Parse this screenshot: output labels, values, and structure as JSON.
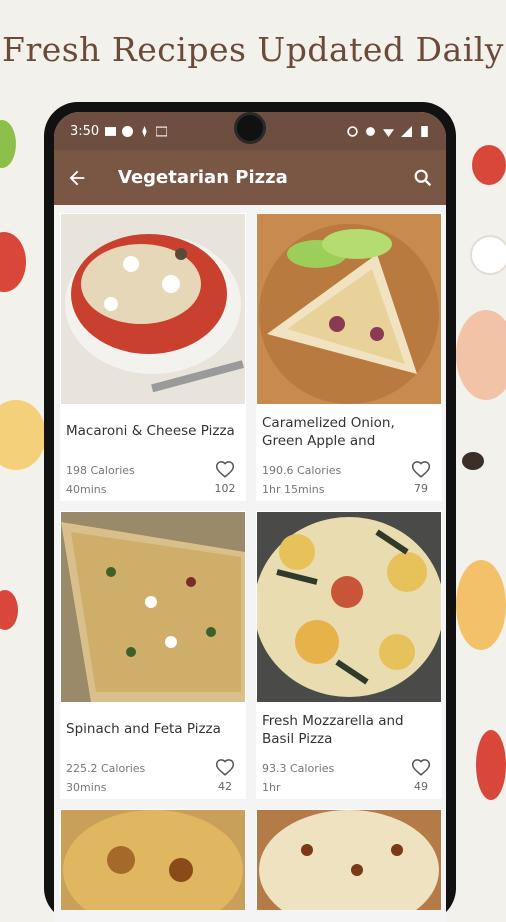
{
  "headline": "Fresh Recipes Updated Daily",
  "status": {
    "time": "3:50"
  },
  "appbar": {
    "title": "Vegetarian Pizza",
    "back_icon": "arrow-left-icon",
    "search_icon": "search-icon"
  },
  "colors": {
    "appbar": "#7a5645",
    "statusbar": "#6e4e40",
    "accent": "#6b4a3a"
  },
  "recipes": [
    {
      "name": "Macaroni & Cheese Pizza",
      "calories": "198 Calories",
      "time": "40mins",
      "likes": "102"
    },
    {
      "name": "Caramelized Onion, Green Apple and",
      "calories": "190.6 Calories",
      "time": "1hr 15mins",
      "likes": "79"
    },
    {
      "name": "Spinach and Feta Pizza",
      "calories": "225.2 Calories",
      "time": "30mins",
      "likes": "42"
    },
    {
      "name": "Fresh Mozzarella and Basil Pizza",
      "calories": "93.3 Calories",
      "time": "1hr",
      "likes": "49"
    }
  ]
}
